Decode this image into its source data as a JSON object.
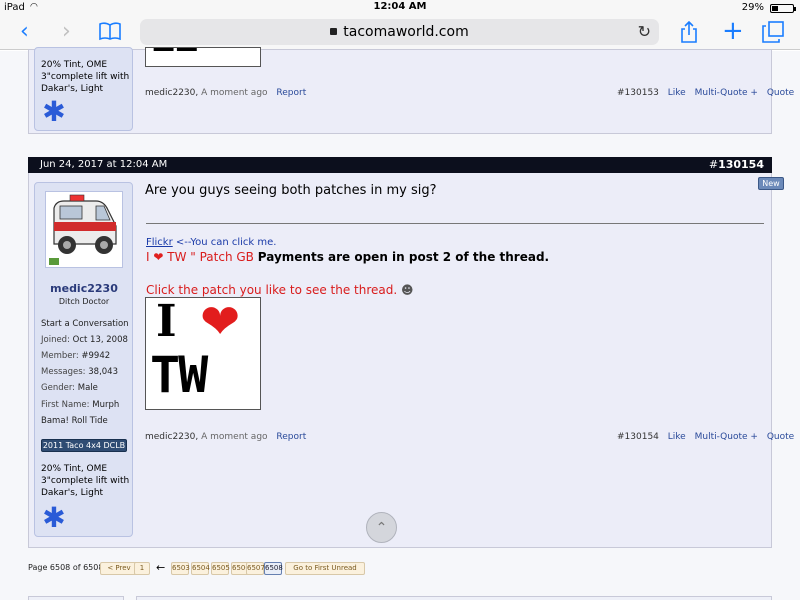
{
  "status": {
    "device": "iPad",
    "time": "12:04 AM",
    "battery": "29%",
    "battery_level": 0.29
  },
  "browser": {
    "url": "tacomaworld.com"
  },
  "prev_post": {
    "sig_lines": [
      "20% Tint, OME",
      "3\"complete lift with",
      "Dakar's, Light"
    ],
    "author": "medic2230,",
    "time": "A moment ago",
    "report": "Report",
    "num": "#130153",
    "like": "Like",
    "multiquote": "Multi-Quote +",
    "quote": "Quote"
  },
  "post": {
    "date": "Jun 24, 2017 at 12:04 AM",
    "number_prefix": "#",
    "number": "130154",
    "new_badge": "New",
    "message": "Are you guys seeing both patches in my sig?",
    "sig_flickr": "Flickr",
    "sig_flickr_rest": "<--You can click me.",
    "sig_line2_pre": "I",
    "sig_line2_mid": "TW \" Patch GB",
    "sig_line2_bold": "Payments are open in post 2 of the thread.",
    "sig_line3": "Click the patch you like to see the thread.",
    "patch_top": "I",
    "patch_bottom": "TW",
    "author": "medic2230,",
    "time": "A moment ago",
    "report": "Report",
    "num": "#130154",
    "like": "Like",
    "multiquote": "Multi-Quote +",
    "quote": "Quote"
  },
  "user": {
    "name": "medic2230",
    "title": "Ditch Doctor",
    "start_conversation": "Start a Conversation",
    "joined_label": "Joined:",
    "joined": "Oct 13, 2008",
    "member_label": "Member:",
    "member": "#9942",
    "messages_label": "Messages:",
    "messages": "38,043",
    "gender_label": "Gender:",
    "gender": "Male",
    "firstname_label": "First Name:",
    "firstname": "Murph",
    "motto": "Bama! Roll Tide",
    "truck_badge": "2011 Taco 4x4 DCLB",
    "sig_lines": [
      "20% Tint, OME",
      "3\"complete lift with",
      "Dakar's, Light"
    ]
  },
  "pagination": {
    "label": "Page 6508 of 6508",
    "prev": "< Prev",
    "first": "1",
    "arrow": "←",
    "pages": [
      "6503",
      "6504",
      "6505",
      "6506",
      "6507",
      "6508"
    ],
    "current": "6508",
    "go_unread": "Go to First Unread"
  }
}
